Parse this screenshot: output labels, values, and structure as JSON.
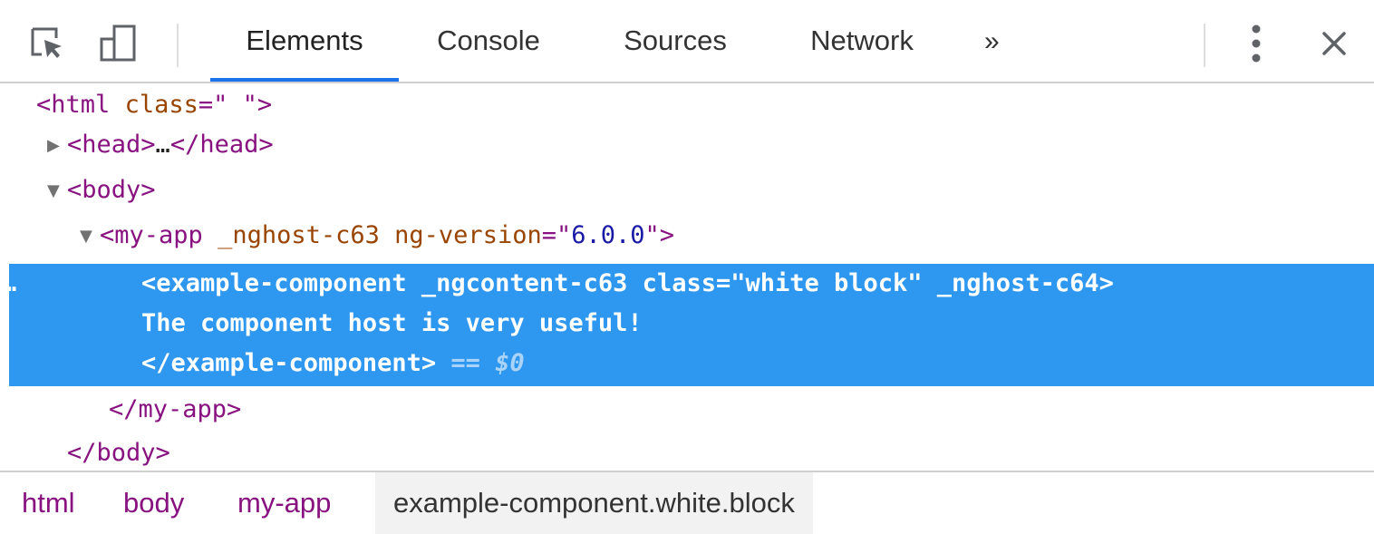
{
  "toolbar": {
    "inspect_icon": "inspect-element-icon",
    "device_icon": "device-toolbar-icon",
    "tabs": [
      {
        "label": "Elements",
        "active": true
      },
      {
        "label": "Console",
        "active": false
      },
      {
        "label": "Sources",
        "active": false
      },
      {
        "label": "Network",
        "active": false
      }
    ],
    "overflow_label": "»",
    "more_icon": "vertical-dots-icon",
    "close_icon": "close-icon",
    "accent_color": "#1a73e8"
  },
  "tree": {
    "html_open": {
      "lt": "<",
      "tag": "html",
      "attr": "class",
      "eq": "=\"",
      "val": " ",
      "end": "\">"
    },
    "head": {
      "open": "<head>",
      "ellipsis": "…",
      "close": "</head>"
    },
    "body_open": "<body>",
    "my_app": {
      "lt": "<",
      "tag": "my-app",
      "attr1": "_nghost-c63",
      "attr2": "ng-version",
      "eq": "=\"",
      "val": "6.0.0",
      "end": "\">"
    },
    "selected": {
      "ellipsis": "…",
      "line1": "<example-component _ngcontent-c63 class=\"white block\" _nghost-c64>",
      "line2": "The component host is very useful!",
      "line3": "</example-component>",
      "eq": " == ",
      "dollar": "$0",
      "highlight_color": "#2e97f0"
    },
    "my_app_close": "</my-app>",
    "body_close": "</body>"
  },
  "breadcrumbs": [
    {
      "label": "html",
      "active": false
    },
    {
      "label": "body",
      "active": false
    },
    {
      "label": "my-app",
      "active": false
    },
    {
      "label": "example-component.white.block",
      "active": true
    }
  ]
}
